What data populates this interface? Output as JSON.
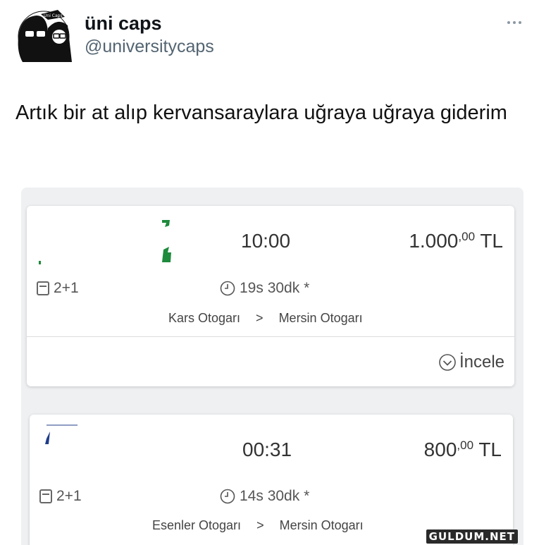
{
  "tweet": {
    "display_name": "üni caps",
    "handle": "@universitycaps",
    "avatar_label": "Üni Caps",
    "text": "Artık bir at alıp kervansaraylara uğraya uğraya giderim"
  },
  "tickets": [
    {
      "time": "10:00",
      "price_main": "1.000",
      "price_decimal": ",00",
      "currency": "TL",
      "seat_layout": "2+1",
      "duration": "19s 30dk *",
      "from": "Kars Otogarı",
      "to": "Mersin Otogarı",
      "details_label": "İncele",
      "logo_color": "#1e8a3c"
    },
    {
      "time": "00:31",
      "price_main": "800",
      "price_decimal": ",00",
      "currency": "TL",
      "seat_layout": "2+1",
      "duration": "14s 30dk *",
      "from": "Esenler Otogarı",
      "to": "Mersin Otogarı",
      "logo_color": "#1f3c88"
    }
  ],
  "route_separator": ">",
  "watermark": "GULDUM.NET",
  "icons": {
    "more": "more-icon",
    "seat": "seat-icon",
    "clock": "clock-icon",
    "chevron": "chevron-down-circle-icon"
  }
}
